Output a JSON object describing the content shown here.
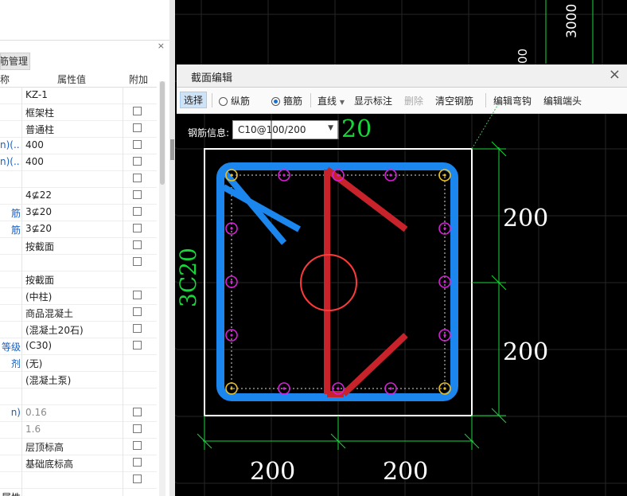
{
  "left_panel": {
    "tab_label": "筋管理",
    "close_glyph": "×",
    "header": {
      "col1": "称",
      "col2": "属性值",
      "col3": "附加"
    },
    "rows": [
      {
        "name": "",
        "value": "KZ-1",
        "name_color": "#222",
        "value_color": "#222",
        "checkbox": false
      },
      {
        "name": "",
        "value": "框架柱",
        "name_color": "#222",
        "value_color": "#222",
        "checkbox": true
      },
      {
        "name": "",
        "value": "普通柱",
        "name_color": "#222",
        "value_color": "#222",
        "checkbox": true
      },
      {
        "name": "n)(...",
        "value": "400",
        "name_color": "#1a5fc0",
        "value_color": "#222",
        "checkbox": true
      },
      {
        "name": "n)(...",
        "value": "400",
        "name_color": "#1a5fc0",
        "value_color": "#222",
        "checkbox": true
      },
      {
        "name": "",
        "value": "",
        "name_color": "#222",
        "value_color": "#222",
        "checkbox": true
      },
      {
        "name": "",
        "value": "4⊈22",
        "name_color": "#222",
        "value_color": "#222",
        "checkbox": true
      },
      {
        "name": "筋",
        "value": "3⊈20",
        "name_color": "#1a5fc0",
        "value_color": "#222",
        "checkbox": true
      },
      {
        "name": "筋",
        "value": "3⊈20",
        "name_color": "#1a5fc0",
        "value_color": "#222",
        "checkbox": true
      },
      {
        "name": "",
        "value": "按截面",
        "name_color": "#222",
        "value_color": "#222",
        "checkbox": true
      },
      {
        "name": "",
        "value": "",
        "name_color": "#222",
        "value_color": "#222",
        "checkbox": true
      },
      {
        "name": "",
        "value": "按截面",
        "name_color": "#222",
        "value_color": "#222",
        "checkbox": false
      },
      {
        "name": "",
        "value": "(中柱)",
        "name_color": "#222",
        "value_color": "#222",
        "checkbox": true
      },
      {
        "name": "",
        "value": "商品混凝土",
        "name_color": "#222",
        "value_color": "#222",
        "checkbox": true
      },
      {
        "name": "",
        "value": "(混凝土20石)",
        "name_color": "#222",
        "value_color": "#222",
        "checkbox": true
      },
      {
        "name": "等级",
        "value": "(C30)",
        "name_color": "#1a5fc0",
        "value_color": "#222",
        "checkbox": true
      },
      {
        "name": "剂",
        "value": "(无)",
        "name_color": "#1a5fc0",
        "value_color": "#222",
        "checkbox": false
      },
      {
        "name": "",
        "value": "(混凝土泵)",
        "name_color": "#222",
        "value_color": "#222",
        "checkbox": false
      },
      {
        "name": "",
        "value": "",
        "name_color": "#222",
        "value_color": "#222",
        "checkbox": false
      },
      {
        "name": "n)",
        "value": "0.16",
        "name_color": "#1a5fc0",
        "value_color": "#888",
        "checkbox": true
      },
      {
        "name": "",
        "value": "1.6",
        "name_color": "#222",
        "value_color": "#888",
        "checkbox": true
      },
      {
        "name": "",
        "value": "层顶标高",
        "name_color": "#222",
        "value_color": "#222",
        "checkbox": true
      },
      {
        "name": "",
        "value": "基础底标高",
        "name_color": "#222",
        "value_color": "#222",
        "checkbox": true
      },
      {
        "name": "",
        "value": "",
        "name_color": "#222",
        "value_color": "#222",
        "checkbox": true
      },
      {
        "name": "属性",
        "value": "",
        "name_color": "#222",
        "value_color": "#222",
        "checkbox": false
      }
    ]
  },
  "cad_background": {
    "dim_3000": "3000",
    "dim_partial": "00",
    "line_color": "#18d63a"
  },
  "dialog": {
    "title": "截面编辑",
    "close_glyph": "×",
    "toolbar": {
      "select": "选择",
      "longitudinal": "纵筋",
      "stirrup": "箍筋",
      "stirrup_checked": true,
      "line": "直线",
      "show_annotation": "显示标注",
      "delete": "删除",
      "clear_rebar": "清空钢筋",
      "edit_bend": "编辑弯钩",
      "edit_end": "编辑端头"
    },
    "rebar_info_label": "钢筋信息:",
    "rebar_info_value": "C10@100/200",
    "annotation_20": "20",
    "side_label": "3C20",
    "dim_right_top": "200",
    "dim_right_bottom": "200",
    "dim_bottom_left": "200",
    "dim_bottom_right": "200"
  },
  "colors": {
    "stirrup_blue": "#1b86ee",
    "tie_red": "#c8232a",
    "circle_red": "#ff3a3a",
    "bar_magenta": "#d81ed8",
    "corner_yellow": "#e8c020",
    "dim_green": "#18d63a",
    "grid": "#262626"
  }
}
